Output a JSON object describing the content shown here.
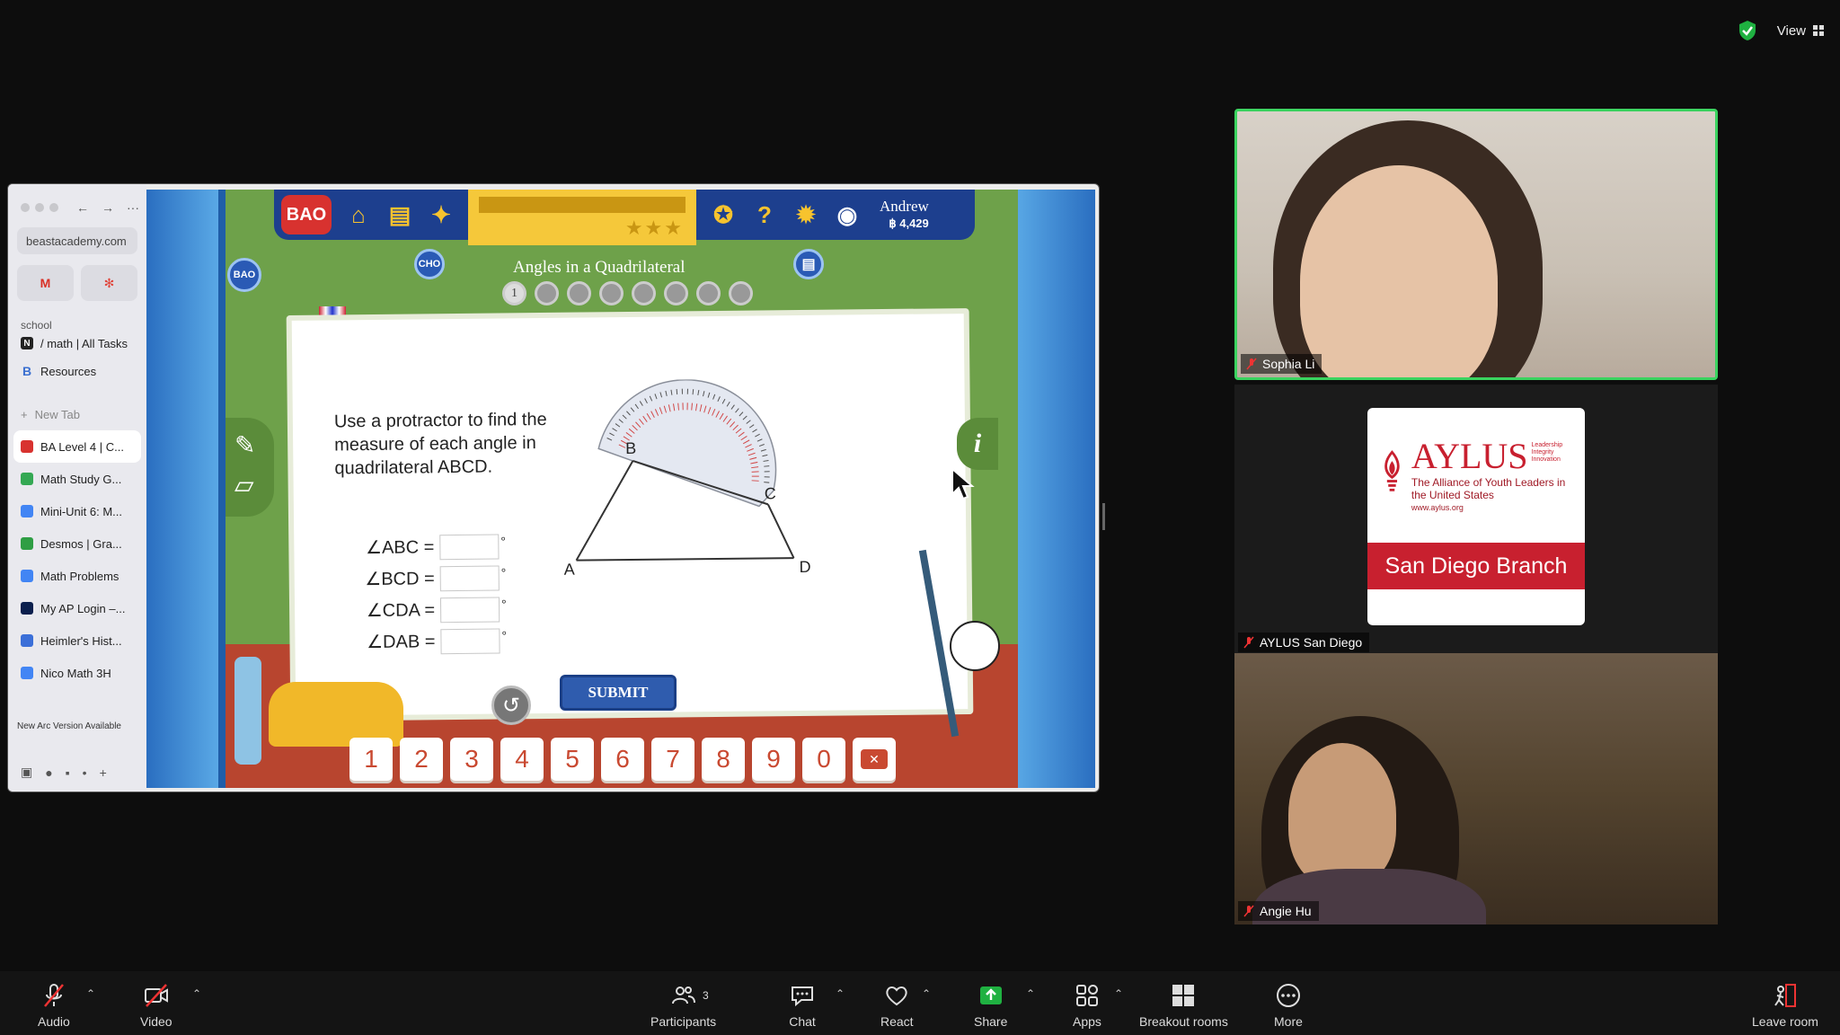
{
  "top": {
    "view_label": "View"
  },
  "browser": {
    "url": "beastacademy.com",
    "pins": [
      "M",
      "✻"
    ],
    "folder_label": "school",
    "folder_items": [
      "/ math | All Tasks",
      "Resources"
    ],
    "new_tab_label": "New Tab",
    "tabs": [
      {
        "label": "BA Level 4 | C...",
        "color": "#d8322f"
      },
      {
        "label": "Math Study G...",
        "color": "#34a853"
      },
      {
        "label": "Mini-Unit 6: M...",
        "color": "#4285f4"
      },
      {
        "label": "Desmos | Gra...",
        "color": "#2f9e44"
      },
      {
        "label": "Math Problems",
        "color": "#4285f4"
      },
      {
        "label": "My AP Login –...",
        "color": "#0b1f4d"
      },
      {
        "label": "Heimler's Hist...",
        "color": "#3b6fd8"
      },
      {
        "label": "Nico Math 3H",
        "color": "#4285f4"
      }
    ],
    "update_banner": "New Arc Version Available"
  },
  "game": {
    "logo": "BAO",
    "user_name": "Andrew",
    "user_points": "฿ 4,429",
    "lesson_title": "Angles in a Quadrilateral",
    "lesson_steps": [
      "1",
      "",
      "",
      "",
      "",
      "",
      "",
      ""
    ],
    "badge_label": "CHO",
    "question": "Use a protractor to find the measure of each angle in quadrilateral ABCD.",
    "angles": [
      "∠ABC =",
      "∠BCD =",
      "∠CDA =",
      "∠DAB ="
    ],
    "degree_symbol": "°",
    "vertices": {
      "a": "A",
      "b": "B",
      "c": "C",
      "d": "D"
    },
    "submit_label": "SUBMIT",
    "keypad": [
      "1",
      "2",
      "3",
      "4",
      "5",
      "6",
      "7",
      "8",
      "9",
      "0"
    ],
    "info_label": "i"
  },
  "participants": [
    {
      "name": "Sophia Li",
      "muted": true
    },
    {
      "name": "AYLUS San Diego",
      "muted": true
    },
    {
      "name": "Angie Hu",
      "muted": true
    }
  ],
  "aylus": {
    "title": "AYLUS",
    "tagline": "Leadership Integrity Innovation",
    "subtitle": "The Alliance of Youth Leaders in the United States",
    "url": "www.aylus.org",
    "branch": "San Diego Branch"
  },
  "toolbar": {
    "audio": "Audio",
    "video": "Video",
    "participants": "Participants",
    "participants_count": "3",
    "chat": "Chat",
    "react": "React",
    "share": "Share",
    "apps": "Apps",
    "breakout": "Breakout rooms",
    "more": "More",
    "leave": "Leave room"
  },
  "colors": {
    "accent_green": "#3ad35f",
    "share_green": "#1fb141",
    "aylus_red": "#c8202f"
  }
}
